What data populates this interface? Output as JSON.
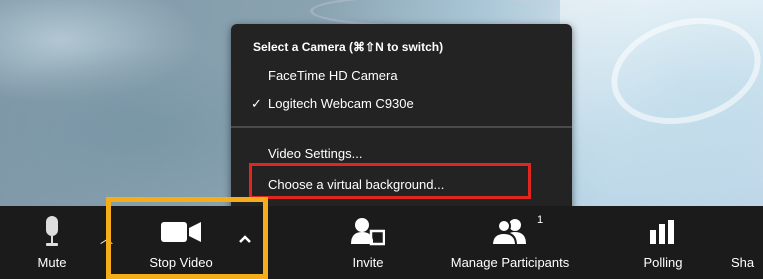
{
  "camera_menu": {
    "header": "Select a Camera (⌘⇧N to switch)",
    "items": [
      {
        "label": "FaceTime HD Camera",
        "checked": false
      },
      {
        "label": "Logitech Webcam C930e",
        "checked": true
      }
    ],
    "check_glyph": "✓",
    "video_settings": "Video Settings...",
    "virtual_background": "Choose a virtual background..."
  },
  "toolbar": {
    "mute_label": "Mute",
    "stop_video_label": "Stop Video",
    "invite_label": "Invite",
    "manage_participants_label": "Manage Participants",
    "participant_count": "1",
    "polling_label": "Polling",
    "share_label": "Sha",
    "icons": [
      "microphone-icon",
      "chevron-up-icon",
      "video-camera-icon",
      "add-person-icon",
      "participants-icon",
      "bar-chart-icon"
    ]
  },
  "colors": {
    "toolbar_bg": "#1b1b1b",
    "menu_bg": "#232323",
    "highlight_red": "#e0261f",
    "highlight_yellow": "#f6ad1a"
  }
}
